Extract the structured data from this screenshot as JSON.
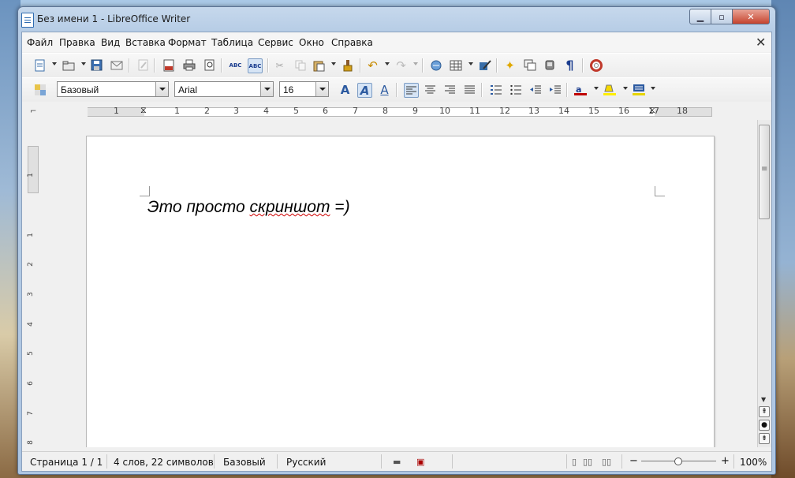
{
  "window": {
    "title": "Без имени 1 - LibreOffice Writer"
  },
  "menubar": {
    "items": [
      {
        "label": "Файл"
      },
      {
        "label": "Правка"
      },
      {
        "label": "Вид"
      },
      {
        "label": "Вставка"
      },
      {
        "label": "Формат"
      },
      {
        "label": "Таблица"
      },
      {
        "label": "Сервис"
      },
      {
        "label": "Окно"
      },
      {
        "label": "Справка"
      }
    ]
  },
  "formatting": {
    "style": "Базовый",
    "font": "Arial",
    "size": "16"
  },
  "toolbar_icons": {
    "new": "new-document-icon",
    "open": "open-folder-icon",
    "save": "save-icon",
    "email": "email-icon",
    "edit": "edit-file-icon",
    "pdf": "export-pdf-icon",
    "print": "print-icon",
    "preview": "print-preview-icon",
    "spell": "spellcheck-icon",
    "autospell": "autospellcheck-icon",
    "cut": "cut-icon",
    "copy": "copy-icon",
    "paste": "paste-icon",
    "clone": "clone-formatting-icon",
    "undo": "undo-icon",
    "redo": "redo-icon",
    "hyperlink": "hyperlink-icon",
    "table": "table-icon",
    "draw": "show-draw-functions-icon",
    "find": "find-replace-icon",
    "navigator": "navigator-icon",
    "gallery": "gallery-icon",
    "datasources": "data-sources-icon",
    "pilcrow": "formatting-marks-icon",
    "help": "help-icon"
  },
  "ruler": {
    "h_ticks": [
      "1",
      "1",
      "2",
      "3",
      "4",
      "5",
      "6",
      "7",
      "8",
      "9",
      "10",
      "11",
      "12",
      "13",
      "14",
      "15",
      "16",
      "17",
      "18"
    ],
    "v_ticks": [
      "1",
      "1",
      "2",
      "3",
      "4",
      "5",
      "6",
      "7",
      "8"
    ]
  },
  "document": {
    "text_before": "Это просто ",
    "text_misspelled": "скриншот",
    "text_after": " =)"
  },
  "statusbar": {
    "page": "Страница 1 / 1",
    "words": "4 слов, 22 символов",
    "style": "Базовый",
    "language": "Русский",
    "zoom": "100%",
    "zoom_level": 1.0
  },
  "colors": {
    "accent": "#2d6ab0",
    "close_button": "#c5432d",
    "spell_underline": "#d00000"
  }
}
